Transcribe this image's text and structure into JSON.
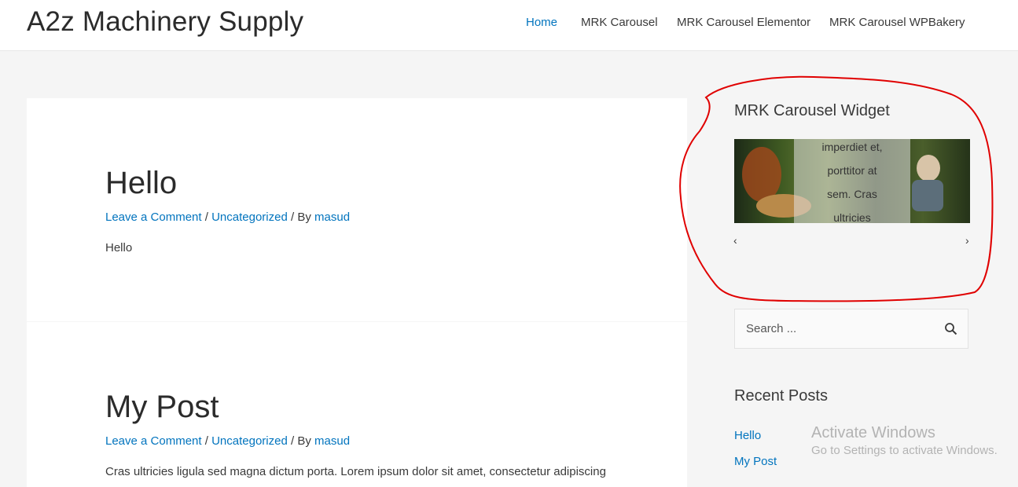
{
  "site": {
    "title": "A2z Machinery Supply"
  },
  "nav": {
    "items": [
      {
        "label": "Home",
        "active": true
      },
      {
        "label": "MRK Carousel",
        "active": false
      },
      {
        "label": "MRK Carousel Elementor",
        "active": false
      },
      {
        "label": "MRK Carousel WPBakery",
        "active": false
      }
    ]
  },
  "posts": [
    {
      "title": "Hello",
      "meta": {
        "comment": "Leave a Comment",
        "sep1": " / ",
        "category": "Uncategorized",
        "sep2": " / By ",
        "author": "masud"
      },
      "excerpt": "Hello"
    },
    {
      "title": "My Post",
      "meta": {
        "comment": "Leave a Comment",
        "sep1": " / ",
        "category": "Uncategorized",
        "sep2": " / By ",
        "author": "masud"
      },
      "excerpt": "Cras ultricies ligula sed magna dictum porta. Lorem ipsum dolor sit amet, consectetur adipiscing"
    }
  ],
  "sidebar": {
    "carousel_widget": {
      "title": "MRK Carousel Widget",
      "caption_lines": [
        "imperdiet et,",
        "porttitor at",
        "sem. Cras",
        "ultricies"
      ],
      "prev": "‹",
      "next": "›"
    },
    "search": {
      "placeholder": "Search ...",
      "icon": "search-icon"
    },
    "recent_posts": {
      "title": "Recent Posts",
      "items": [
        "Hello",
        "My Post"
      ]
    }
  },
  "watermark": {
    "title": "Activate Windows",
    "subtitle": "Go to Settings to activate Windows."
  },
  "colors": {
    "link": "#0274be",
    "annotation": "#e00000",
    "text": "#3a3a3a",
    "background": "#f5f5f5"
  }
}
